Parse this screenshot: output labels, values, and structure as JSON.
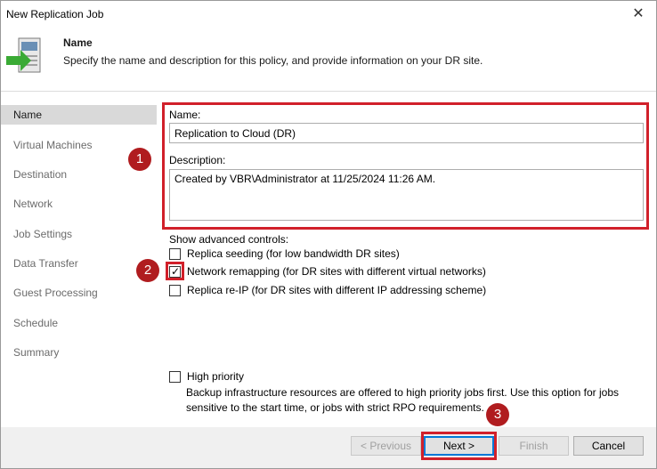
{
  "window": {
    "title": "New Replication Job",
    "close_glyph": "✕"
  },
  "header": {
    "title": "Name",
    "description": "Specify the name and description for this policy, and provide information on your DR site.",
    "icon": "replication-job-icon"
  },
  "sidebar": {
    "items": [
      {
        "label": "Name",
        "active": true
      },
      {
        "label": "Virtual Machines"
      },
      {
        "label": "Destination"
      },
      {
        "label": "Network"
      },
      {
        "label": "Job Settings"
      },
      {
        "label": "Data Transfer"
      },
      {
        "label": "Guest Processing"
      },
      {
        "label": "Schedule"
      },
      {
        "label": "Summary"
      }
    ]
  },
  "form": {
    "name_label": "Name:",
    "name_value": "Replication to Cloud (DR)",
    "description_label": "Description:",
    "description_value": "Created by VBR\\Administrator at 11/25/2024 11:26 AM.",
    "advanced_label": "Show advanced controls:",
    "options": [
      {
        "label": "Replica seeding (for low bandwidth DR sites)",
        "checked": false
      },
      {
        "label": "Network remapping (for DR sites with different virtual networks)",
        "checked": true
      },
      {
        "label": "Replica re-IP (for DR sites with different IP addressing scheme)",
        "checked": false
      }
    ],
    "high_priority_label": "High priority",
    "high_priority_checked": false,
    "high_priority_help_1": "Backup infrastructure resources are offered to high priority jobs first. Use this option for jobs",
    "high_priority_help_2": "sensitive to the start time, or jobs with strict RPO requirements.",
    "check_glyph": "✓"
  },
  "annotations": {
    "marker_1": "1",
    "marker_2": "2",
    "marker_3": "3",
    "accent": "#d1202a"
  },
  "footer": {
    "previous_label": "< Previous",
    "next_label": "Next >",
    "finish_label": "Finish",
    "cancel_label": "Cancel"
  }
}
